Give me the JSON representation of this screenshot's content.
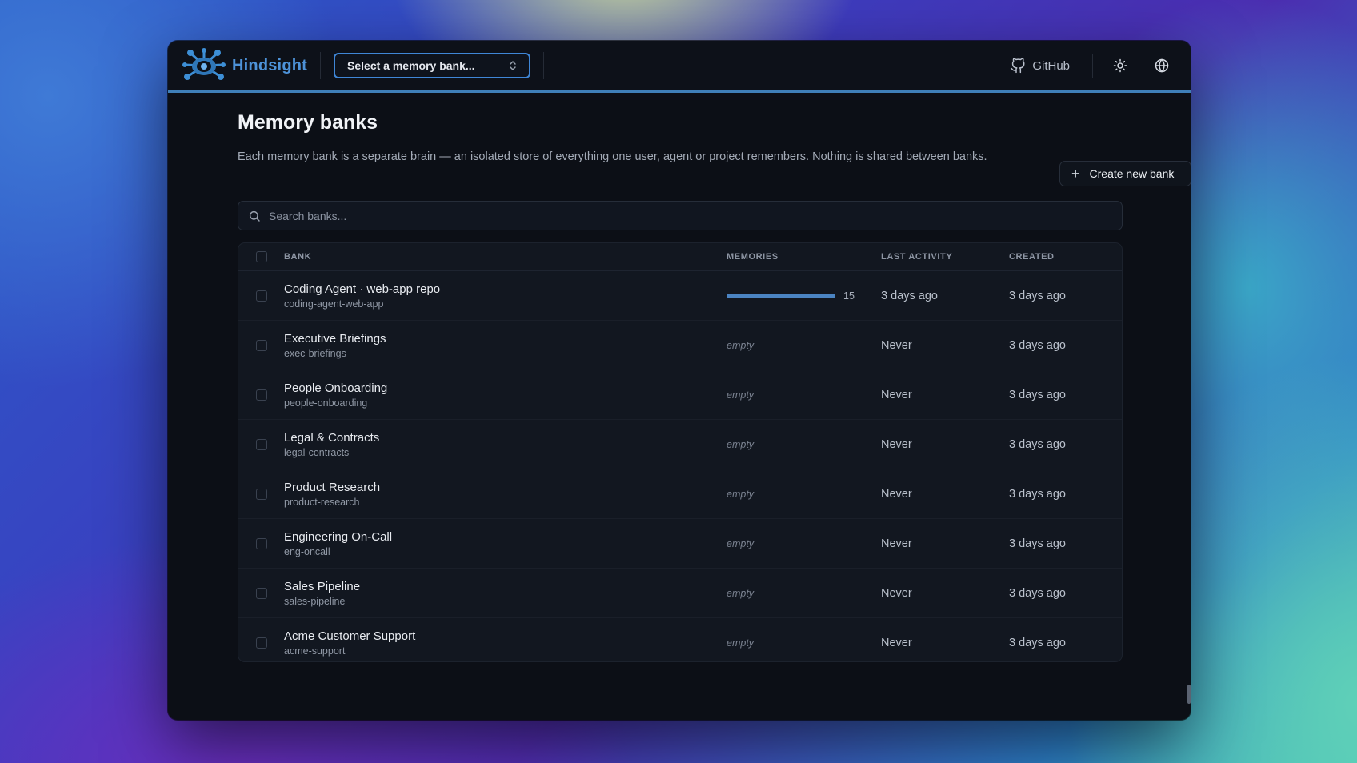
{
  "app": {
    "name": "Hindsight",
    "bank_select_placeholder": "Select a memory bank...",
    "github_label": "GitHub",
    "accent": "#3f86d6"
  },
  "page": {
    "title": "Memory banks",
    "description": "Each memory bank is a separate brain — an isolated store of everything one user, agent or project remembers. Nothing is shared between banks.",
    "create_button": "Create new bank",
    "search_placeholder": "Search banks..."
  },
  "table": {
    "headers": {
      "bank": "BANK",
      "memories": "MEMORIES",
      "last_activity": "LAST ACTIVITY",
      "created": "CREATED"
    },
    "max_memories": 15,
    "rows": [
      {
        "name": "Coding Agent · web-app repo",
        "id": "coding-agent-web-app",
        "memories": 15,
        "memories_label": "15",
        "last_activity": "3 days ago",
        "created": "3 days ago"
      },
      {
        "name": "Executive Briefings",
        "id": "exec-briefings",
        "memories": 0,
        "memories_label": "empty",
        "last_activity": "Never",
        "created": "3 days ago"
      },
      {
        "name": "People Onboarding",
        "id": "people-onboarding",
        "memories": 0,
        "memories_label": "empty",
        "last_activity": "Never",
        "created": "3 days ago"
      },
      {
        "name": "Legal & Contracts",
        "id": "legal-contracts",
        "memories": 0,
        "memories_label": "empty",
        "last_activity": "Never",
        "created": "3 days ago"
      },
      {
        "name": "Product Research",
        "id": "product-research",
        "memories": 0,
        "memories_label": "empty",
        "last_activity": "Never",
        "created": "3 days ago"
      },
      {
        "name": "Engineering On-Call",
        "id": "eng-oncall",
        "memories": 0,
        "memories_label": "empty",
        "last_activity": "Never",
        "created": "3 days ago"
      },
      {
        "name": "Sales Pipeline",
        "id": "sales-pipeline",
        "memories": 0,
        "memories_label": "empty",
        "last_activity": "Never",
        "created": "3 days ago"
      },
      {
        "name": "Acme Customer Support",
        "id": "acme-support",
        "memories": 0,
        "memories_label": "empty",
        "last_activity": "Never",
        "created": "3 days ago"
      }
    ]
  },
  "icons": {
    "logo": "eye-creature-icon",
    "select_chevron": "chevron-up-down-icon",
    "github": "github-icon",
    "theme": "sun-icon",
    "language": "globe-icon",
    "create": "plus-icon",
    "search": "search-icon"
  }
}
